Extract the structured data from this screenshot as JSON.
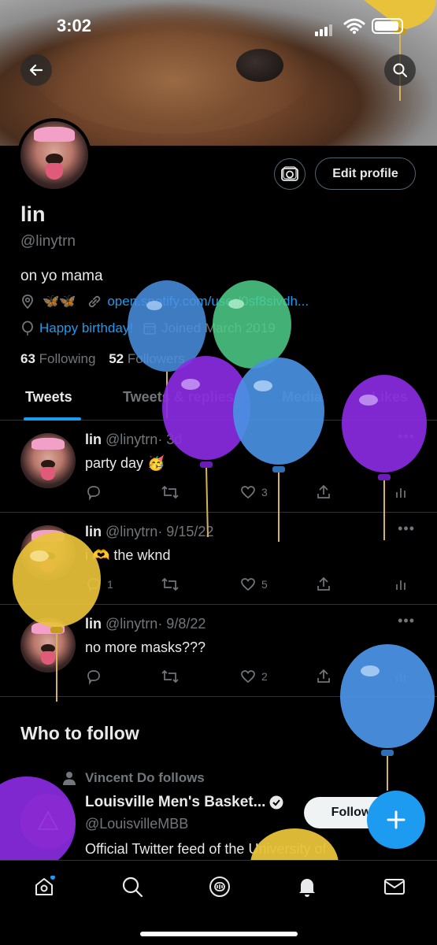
{
  "status_bar": {
    "time": "3:02"
  },
  "profile": {
    "name": "lin",
    "handle": "@linytrn",
    "bio": "on yo mama",
    "location_emoji": "🦋🦋",
    "link": "open.spotify.com/user/0sf8sivdh...",
    "birthday": "Happy birthday!",
    "joined": "Joined March 2019",
    "following_count": "63",
    "following_label": "Following",
    "followers_count": "52",
    "followers_label": "Followers",
    "edit_label": "Edit profile"
  },
  "tabs": [
    "Tweets",
    "Tweets & replies",
    "Media",
    "Likes"
  ],
  "tweets": [
    {
      "name": "lin",
      "handle": "@linytrn",
      "date": "· 3d",
      "text": "party day 🥳",
      "replies": "",
      "retweets": "",
      "likes": "3",
      "views": ""
    },
    {
      "name": "lin",
      "handle": "@linytrn",
      "date": "· 9/15/22",
      "text": "i 🫶 the wknd",
      "replies": "1",
      "retweets": "",
      "likes": "5",
      "views": ""
    },
    {
      "name": "lin",
      "handle": "@linytrn",
      "date": "· 9/8/22",
      "text": "no more masks???",
      "replies": "",
      "retweets": "",
      "likes": "2",
      "views": ""
    }
  ],
  "who_to_follow": {
    "title": "Who to follow",
    "context": "Vincent Do follows",
    "name": "Louisville Men's Basket...",
    "handle": "@LouisvilleMBB",
    "description": "Official Twitter feed of the University of",
    "follow_label": "Follow"
  },
  "colors": {
    "accent": "#1d9bf0",
    "background": "#000000",
    "muted": "#71767b"
  },
  "icons": [
    "back-arrow-icon",
    "search-icon",
    "camera-icon",
    "location-icon",
    "link-icon",
    "balloon-icon",
    "calendar-icon",
    "reply-icon",
    "retweet-icon",
    "like-icon",
    "share-icon",
    "views-icon",
    "more-icon",
    "person-icon",
    "verified-icon",
    "plus-icon",
    "home-icon",
    "explore-icon",
    "spaces-icon",
    "bell-icon",
    "mail-icon"
  ]
}
